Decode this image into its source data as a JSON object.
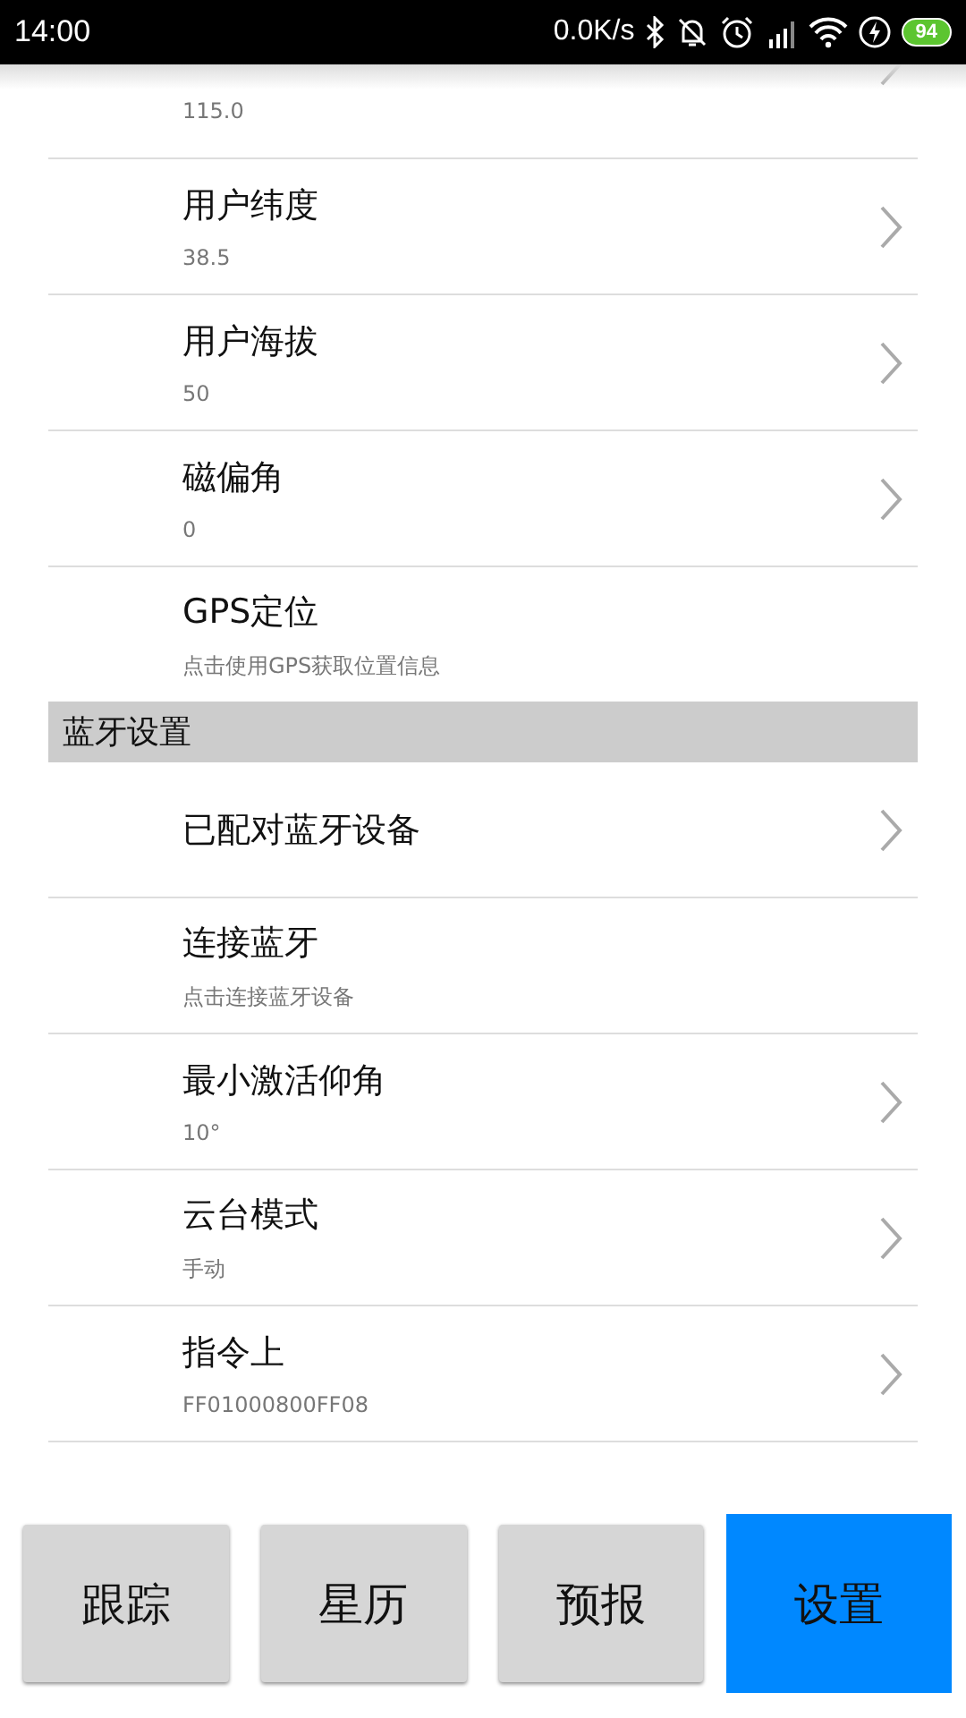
{
  "status_bar": {
    "time": "14:00",
    "net_speed": "0.0K/s",
    "battery": "94"
  },
  "list": [
    {
      "kind": "nav",
      "subtitle": "115.0"
    },
    {
      "kind": "nav",
      "title": "用户纬度",
      "subtitle": "38.5"
    },
    {
      "kind": "nav",
      "title": "用户海拔",
      "subtitle": "50"
    },
    {
      "kind": "nav",
      "title": "磁偏角",
      "subtitle": "0"
    },
    {
      "kind": "action",
      "title": "GPS定位",
      "subtitle": "点击使用GPS获取位置信息"
    },
    {
      "kind": "header",
      "title": "蓝牙设置"
    },
    {
      "kind": "nav",
      "title": "已配对蓝牙设备"
    },
    {
      "kind": "action",
      "title": "连接蓝牙",
      "subtitle": "点击连接蓝牙设备"
    },
    {
      "kind": "nav",
      "title": "最小激活仰角",
      "subtitle": "10°"
    },
    {
      "kind": "nav",
      "title": "云台模式",
      "subtitle": "手动"
    },
    {
      "kind": "nav",
      "title": "指令上",
      "subtitle": "FF01000800FF08"
    }
  ],
  "tabs": [
    {
      "label": "跟踪",
      "selected": false
    },
    {
      "label": "星历",
      "selected": false
    },
    {
      "label": "预报",
      "selected": false
    },
    {
      "label": "设置",
      "selected": true
    }
  ]
}
